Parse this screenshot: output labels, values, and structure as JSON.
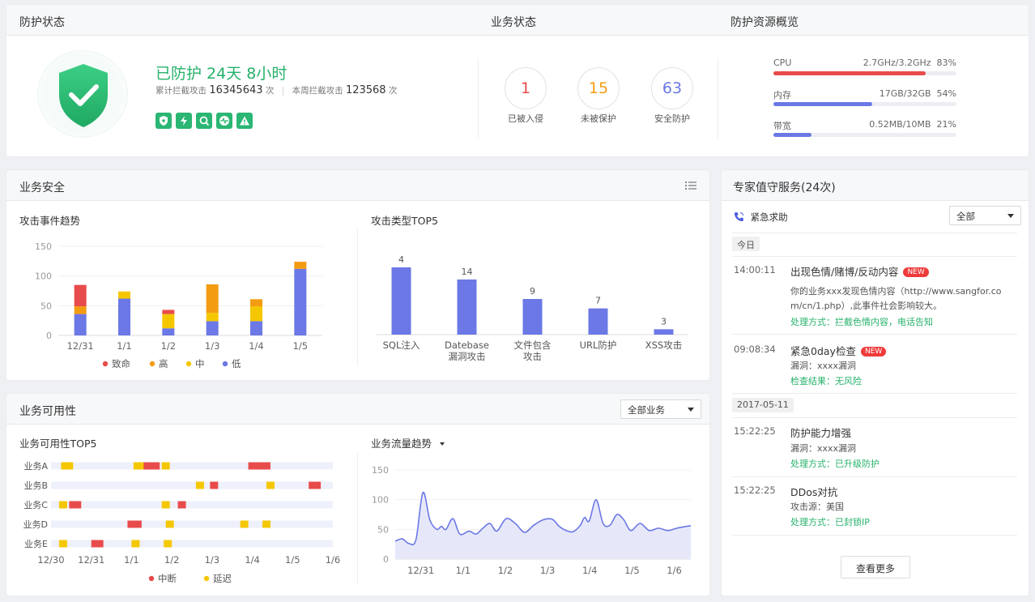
{
  "top": {
    "protect_title": "防护状态",
    "business_status_title": "业务状态",
    "resource_title": "防护资源概览",
    "protect_status": "已防护 24天 8小时",
    "total_attack_label": "累计拦截攻击",
    "total_attack_value": "16345643",
    "total_attack_unit": "次",
    "week_attack_label": "本周拦截攻击",
    "week_attack_value": "123568",
    "week_attack_unit": "次",
    "feature_icons": [
      "shield-plus-icon",
      "bolt-icon",
      "search-icon",
      "heartbeat-icon",
      "warning-icon"
    ],
    "stats": [
      {
        "value": "1",
        "label": "已被入侵",
        "color": "#e84b4b"
      },
      {
        "value": "15",
        "label": "未被保护",
        "color": "#f39c12"
      },
      {
        "value": "63",
        "label": "安全防护",
        "color": "#6b78e5"
      }
    ],
    "resources": [
      {
        "label": "CPU",
        "value": "2.7GHz/3.2GHz",
        "percent": "83%",
        "ratio": 0.83,
        "color": "#e84b4b"
      },
      {
        "label": "内存",
        "value": "17GB/32GB",
        "percent": "54%",
        "ratio": 0.54,
        "color": "#6b78e5"
      },
      {
        "label": "带宽",
        "value": "0.52MB/10MB",
        "percent": "21%",
        "ratio": 0.21,
        "color": "#6b78e5"
      }
    ]
  },
  "security": {
    "title": "业务安全",
    "trend_title": "攻击事件趋势",
    "top5_title": "攻击类型TOP5"
  },
  "availability": {
    "title": "业务可用性",
    "select_value": "全部业务",
    "top5_title": "业务可用性TOP5",
    "traffic_title": "业务流量趋势"
  },
  "expert": {
    "title": "专家值守服务(24次)",
    "emergency_label": "紧急求助",
    "filter_value": "全部",
    "date_today": "今日",
    "date_2": "2017-05-11",
    "events": [
      {
        "time": "14:00:11",
        "title": "出现色情/赌博/反动内容",
        "badge": "NEW",
        "line1": "你的业务xxx发现色情内容（http://www.sangfor.co",
        "line2": "m/cn/1.php）,此事件社会影响较大。",
        "action": "处理方式：拦截色情内容，电话告知"
      },
      {
        "time": "09:08:34",
        "title": "紧急0day检查",
        "badge": "NEW",
        "line1": "漏洞：xxxx漏洞",
        "action": "检查结果：无风险"
      },
      {
        "time": "15:22:25",
        "title": "防护能力增强",
        "line1": "漏洞：xxxx漏洞",
        "action": "处理方式：已升级防护"
      },
      {
        "time": "15:22:25",
        "title": "DDos对抗",
        "line1": "攻击源：美国",
        "action": "处理方式：已封锁IP"
      }
    ],
    "more_label": "查看更多"
  },
  "chart_data": [
    {
      "type": "bar",
      "title": "攻击事件趋势",
      "stacked": true,
      "categories": [
        "12/31",
        "1/1",
        "1/2",
        "1/3",
        "1/4",
        "1/5"
      ],
      "ylim": [
        0,
        150
      ],
      "yticks": [
        0,
        50,
        100,
        150
      ],
      "legend_position": "bottom",
      "series": [
        {
          "name": "低",
          "color": "#6b78e5",
          "values": [
            36,
            62,
            12,
            24,
            24,
            112
          ]
        },
        {
          "name": "中",
          "color": "#f5c700",
          "values": [
            0,
            12,
            24,
            14,
            25,
            0
          ]
        },
        {
          "name": "高",
          "color": "#f39c12",
          "values": [
            13,
            0,
            0,
            48,
            12,
            12
          ]
        },
        {
          "name": "致命",
          "color": "#e84b4b",
          "values": [
            36,
            0,
            7,
            0,
            0,
            0
          ]
        }
      ],
      "legend_order": [
        "致命",
        "高",
        "中",
        "低"
      ]
    },
    {
      "type": "bar",
      "title": "攻击类型TOP5",
      "categories": [
        "SQL注入",
        "Datebase漏洞攻击",
        "文件包含攻击",
        "URL防护",
        "XSS攻击"
      ],
      "category_lines": [
        [
          "SQL注入"
        ],
        [
          "Datebase",
          "漏洞攻击"
        ],
        [
          "文件包含",
          "攻击"
        ],
        [
          "URL防护"
        ],
        [
          "XSS攻击"
        ]
      ],
      "values": [
        4,
        14,
        9,
        7,
        3
      ],
      "bar_ratio": [
        1.0,
        0.82,
        0.53,
        0.39,
        0.08
      ],
      "color": "#6b78e5"
    },
    {
      "type": "timeline",
      "title": "业务可用性TOP5",
      "rows": [
        "业务A",
        "业务B",
        "业务C",
        "业务D",
        "业务E"
      ],
      "x_ticks": [
        "12/30",
        "12/31",
        "1/1",
        "1/2",
        "1/3",
        "1/4",
        "1/5",
        "1/6"
      ],
      "legend": [
        {
          "name": "中断",
          "color": "#e84b4b"
        },
        {
          "name": "延迟",
          "color": "#f5c700"
        }
      ],
      "events": [
        [
          [
            0.25,
            0.3,
            "延迟"
          ],
          [
            2.05,
            0.3,
            "延迟"
          ],
          [
            2.3,
            0.4,
            "中断"
          ],
          [
            2.75,
            0.2,
            "延迟"
          ],
          [
            4.9,
            0.55,
            "中断"
          ]
        ],
        [
          [
            3.6,
            0.2,
            "延迟"
          ],
          [
            3.95,
            0.2,
            "中断"
          ],
          [
            5.35,
            0.2,
            "延迟"
          ],
          [
            6.4,
            0.3,
            "中断"
          ]
        ],
        [
          [
            0.2,
            0.2,
            "延迟"
          ],
          [
            0.45,
            0.3,
            "中断"
          ],
          [
            2.75,
            0.2,
            "延迟"
          ],
          [
            3.15,
            0.2,
            "中断"
          ]
        ],
        [
          [
            1.9,
            0.35,
            "中断"
          ],
          [
            2.85,
            0.2,
            "延迟"
          ],
          [
            4.7,
            0.2,
            "延迟"
          ],
          [
            5.25,
            0.2,
            "延迟"
          ]
        ],
        [
          [
            0.2,
            0.2,
            "延迟"
          ],
          [
            1.0,
            0.3,
            "中断"
          ],
          [
            2.0,
            0.2,
            "延迟"
          ],
          [
            2.8,
            0.2,
            "延迟"
          ]
        ]
      ]
    },
    {
      "type": "area",
      "title": "业务流量趋势",
      "x_ticks": [
        "12/31",
        "1/1",
        "1/2",
        "1/3",
        "1/4",
        "1/5",
        "1/6"
      ],
      "ylim": [
        0,
        150
      ],
      "yticks": [
        0,
        50,
        100,
        150
      ],
      "color": "#6b78e5",
      "x": [
        0,
        0.15,
        0.3,
        0.45,
        0.6,
        0.75,
        0.9,
        1.0,
        1.1,
        1.25,
        1.4,
        1.6,
        1.75,
        1.9,
        2.05,
        2.2,
        2.4,
        2.6,
        2.8,
        3.0,
        3.2,
        3.4,
        3.55,
        3.7,
        3.85,
        4.0,
        4.1,
        4.2,
        4.35,
        4.5,
        4.65,
        4.8,
        4.95,
        5.1,
        5.3,
        5.5,
        5.7,
        5.9,
        6.1,
        6.3,
        6.4
      ],
      "y": [
        30,
        34,
        26,
        33,
        112,
        66,
        50,
        55,
        50,
        68,
        42,
        47,
        42,
        52,
        60,
        47,
        68,
        60,
        45,
        57,
        66,
        67,
        55,
        48,
        46,
        56,
        70,
        64,
        100,
        60,
        57,
        75,
        66,
        48,
        60,
        48,
        52,
        48,
        52,
        55,
        56
      ]
    }
  ]
}
